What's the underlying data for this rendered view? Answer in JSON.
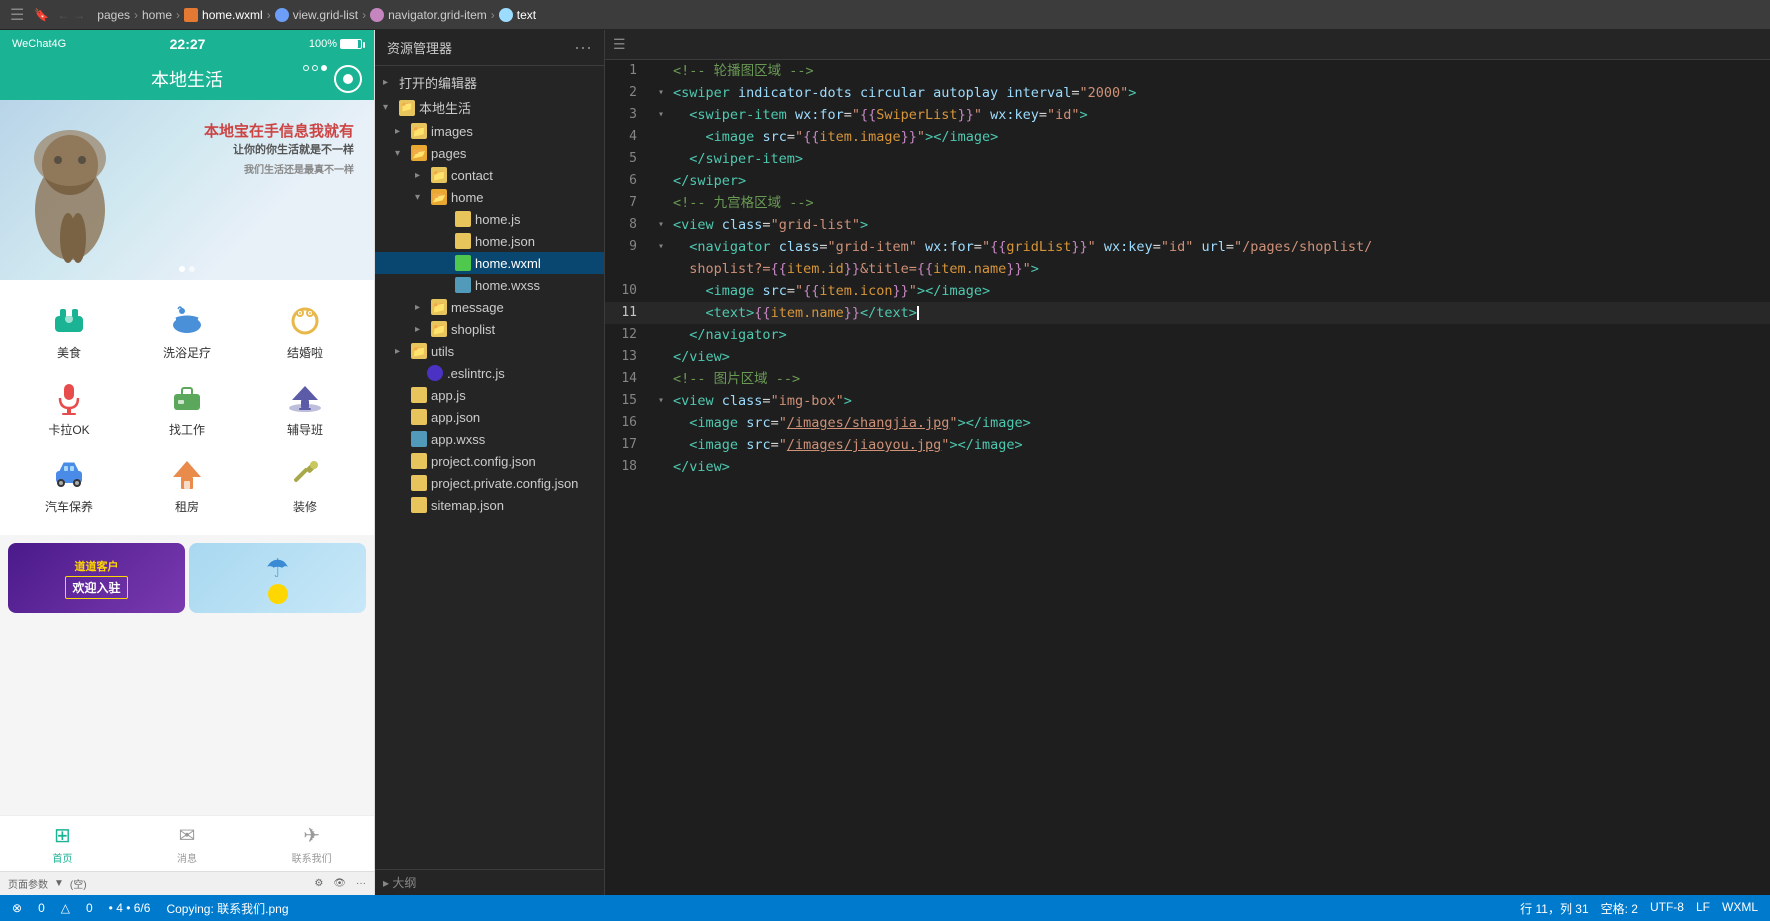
{
  "topbar": {
    "breadcrumb": [
      "pages",
      "home",
      "home.wxml",
      "view.grid-list",
      "navigator.grid-item",
      "text"
    ],
    "bookmark_icon": "🔖",
    "back_icon": "←",
    "forward_icon": "→"
  },
  "phone": {
    "carrier": "WeChat4G",
    "time": "22:27",
    "battery": "100%",
    "title": "本地生活",
    "swiper_text": "本地宝在手信息我就有",
    "swiper_subtext": "让你的你生活就是不一样",
    "grid_items": [
      {
        "label": "美食",
        "icon": "🏔️",
        "color": "#1ab394"
      },
      {
        "label": "洗浴足疗",
        "icon": "🛁",
        "color": "#4a90d9"
      },
      {
        "label": "结婚啦",
        "icon": "💍",
        "color": "#e8b84b"
      },
      {
        "label": "卡拉OK",
        "icon": "🎤",
        "color": "#e84b4b"
      },
      {
        "label": "找工作",
        "icon": "💼",
        "color": "#5ba85c"
      },
      {
        "label": "辅导班",
        "icon": "🎓",
        "color": "#5b5ba8"
      },
      {
        "label": "汽车保养",
        "icon": "🚗",
        "color": "#4b8be8"
      },
      {
        "label": "租房",
        "icon": "🏠",
        "color": "#e88b4b"
      },
      {
        "label": "装修",
        "icon": "🔧",
        "color": "#a8a84b"
      }
    ],
    "nav_items": [
      {
        "label": "首页",
        "icon": "⊞",
        "active": true
      },
      {
        "label": "消息",
        "icon": "✉",
        "active": false
      },
      {
        "label": "联系我们",
        "icon": "✈",
        "active": false
      }
    ],
    "banner1_text": "道道客户\n欢迎入驻",
    "banner2_text": ""
  },
  "file_tree": {
    "header": "资源管理器",
    "open_editor": "打开的编辑器",
    "root": "本地生活",
    "bottom": "大纲",
    "items": [
      {
        "name": "images",
        "type": "folder",
        "level": 1
      },
      {
        "name": "pages",
        "type": "folder-open",
        "level": 1
      },
      {
        "name": "contact",
        "type": "folder",
        "level": 2
      },
      {
        "name": "home",
        "type": "folder-open",
        "level": 2
      },
      {
        "name": "home.js",
        "type": "js",
        "level": 3
      },
      {
        "name": "home.json",
        "type": "json",
        "level": 3
      },
      {
        "name": "home.wxml",
        "type": "wxml",
        "level": 3,
        "selected": true
      },
      {
        "name": "home.wxss",
        "type": "wxss",
        "level": 3
      },
      {
        "name": "message",
        "type": "folder",
        "level": 2
      },
      {
        "name": "shoplist",
        "type": "folder",
        "level": 2
      },
      {
        "name": "utils",
        "type": "folder",
        "level": 1
      },
      {
        "name": ".eslintrc.js",
        "type": "eslint",
        "level": 2
      },
      {
        "name": "app.js",
        "type": "js",
        "level": 1
      },
      {
        "name": "app.json",
        "type": "json",
        "level": 1
      },
      {
        "name": "app.wxss",
        "type": "wxss",
        "level": 1
      },
      {
        "name": "project.config.json",
        "type": "json",
        "level": 1
      },
      {
        "name": "project.private.config.json",
        "type": "json",
        "level": 1
      },
      {
        "name": "sitemap.json",
        "type": "json",
        "level": 1
      }
    ]
  },
  "editor": {
    "lines": [
      {
        "num": 1,
        "fold": "",
        "content": "<!-- 轮播图区域 -->"
      },
      {
        "num": 2,
        "fold": "▾",
        "content": "<swiper indicator-dots circular autoplay interval=\"2000\">"
      },
      {
        "num": 3,
        "fold": "▾",
        "content": "  <swiper-item wx:for=\"{{SwiperList}}\" wx:key=\"id\">"
      },
      {
        "num": 4,
        "fold": "",
        "content": "    <image src=\"{{item.image}}\"></image>"
      },
      {
        "num": 5,
        "fold": "",
        "content": "  </swiper-item>"
      },
      {
        "num": 6,
        "fold": "",
        "content": "</swiper>"
      },
      {
        "num": 7,
        "fold": "",
        "content": "<!-- 九宫格区域 -->"
      },
      {
        "num": 8,
        "fold": "▾",
        "content": "<view class=\"grid-list\">"
      },
      {
        "num": 9,
        "fold": "▾",
        "content": "  <navigator class=\"grid-item\" wx:for=\"{{gridList}}\" wx:key=\"id\" url=\"/pages/shoplist/shoplist?={{item.id}}&title={{item.name}}\">"
      },
      {
        "num": 10,
        "fold": "",
        "content": "    <image src=\"{{item.icon}}\"></image>"
      },
      {
        "num": 11,
        "fold": "",
        "content": "    <text>{{item.name}}</text>"
      },
      {
        "num": 12,
        "fold": "",
        "content": "  </navigator>"
      },
      {
        "num": 13,
        "fold": "",
        "content": "</view>"
      },
      {
        "num": 14,
        "fold": "",
        "content": "<!-- 图片区域 -->"
      },
      {
        "num": 15,
        "fold": "▾",
        "content": "<view class=\"img-box\">"
      },
      {
        "num": 16,
        "fold": "",
        "content": "  <image src=\"/images/shangjia.jpg\"></image>"
      },
      {
        "num": 17,
        "fold": "",
        "content": "  <image src=\"/images/jiaoyou.jpg\"></image>"
      },
      {
        "num": 18,
        "fold": "",
        "content": "</view>"
      }
    ]
  },
  "status_bar": {
    "errors": "⊗ 0 △ 0",
    "file_info": "4 · 6/6",
    "copy_status": "Copying: 联系我们.png",
    "cursor_pos": "行 11，列 31",
    "spaces": "空格: 2",
    "encoding": "UTF-8",
    "line_ending": "LF",
    "file_type": "WXML"
  }
}
